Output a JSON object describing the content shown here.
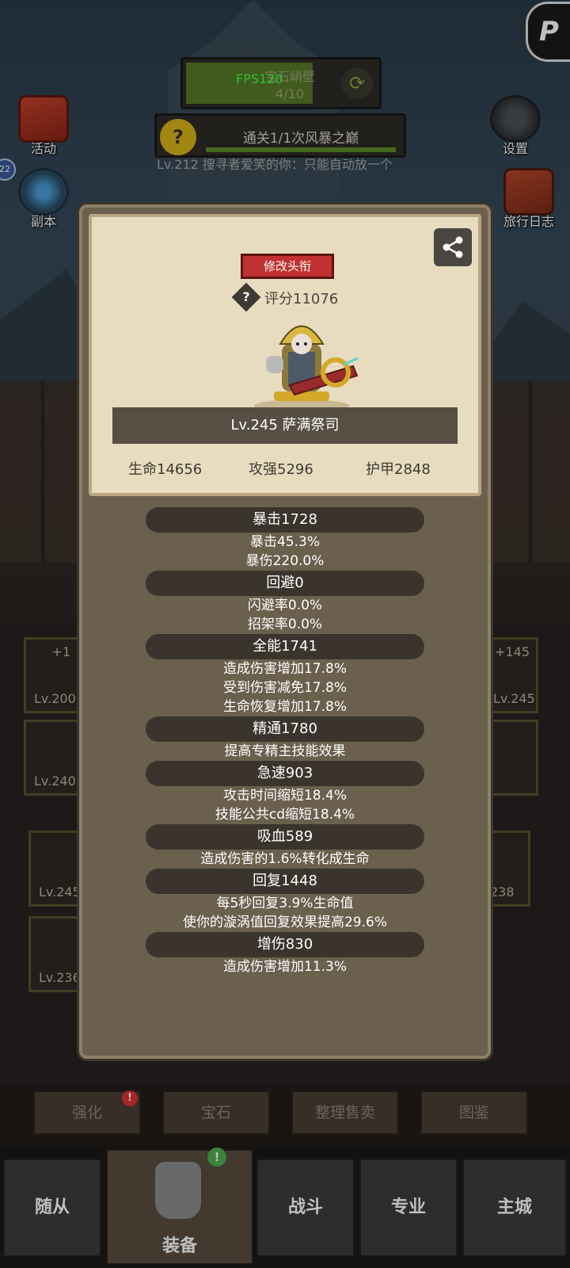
{
  "hud": {
    "mission_name": "宝石峭壁",
    "mission_progress": "4/10",
    "fps": "FPS120",
    "quest_text": "通关1/1次风暴之巅",
    "quest_icon": "?",
    "chat_text": "Lv.212 搜寻者爱笑的你：只能自动放一个",
    "badge_count": "22"
  },
  "side_buttons": {
    "activity": "活动",
    "dungeon": "副本",
    "settings": "设置",
    "journal": "旅行日志"
  },
  "background_slots": [
    {
      "lv": "Lv.200",
      "plus": "+1"
    },
    {
      "lv": "Lv.245",
      "plus": "+145"
    },
    {
      "lv": "Lv.240",
      "plus": ""
    },
    {
      "lv": "Lv.245",
      "plus": ""
    },
    {
      "lv": "Lv.236",
      "plus": ""
    },
    {
      "lv": "238",
      "plus": ""
    }
  ],
  "tools": {
    "enhance": "强化",
    "gem": "宝石",
    "sort_sell": "整理售卖",
    "codex": "图鉴",
    "enhance_alert": "!"
  },
  "nav": {
    "followers": "随从",
    "equipment": "装备",
    "battle": "战斗",
    "profession": "专业",
    "city": "主城",
    "equipment_alert": "!"
  },
  "popup": {
    "title_button": "修改头衔",
    "help_icon": "?",
    "score": "评分11076",
    "hero_name": "Lv.245 萨满祭司",
    "hp": "生命14656",
    "attack": "攻强5296",
    "armor": "护甲2848",
    "attributes": [
      {
        "head": "暴击1728",
        "lines": [
          "暴击45.3%",
          "暴伤220.0%"
        ]
      },
      {
        "head": "回避0",
        "lines": [
          "闪避率0.0%",
          "招架率0.0%"
        ]
      },
      {
        "head": "全能1741",
        "lines": [
          "造成伤害增加17.8%",
          "受到伤害减免17.8%",
          "生命恢复增加17.8%"
        ]
      },
      {
        "head": "精通1780",
        "lines": [
          "提高专精主技能效果"
        ]
      },
      {
        "head": "急速903",
        "lines": [
          "攻击时间缩短18.4%",
          "技能公共cd缩短18.4%"
        ]
      },
      {
        "head": "吸血589",
        "lines": [
          "造成伤害的1.6%转化成生命"
        ]
      },
      {
        "head": "回复1448",
        "lines": [
          "每5秒回复3.9%生命值",
          "使你的漩涡值回复效果提高29.6%"
        ]
      },
      {
        "head": "增伤830",
        "lines": [
          "造成伤害增加11.3%"
        ]
      }
    ]
  },
  "colors": {
    "title_button": "#c23131",
    "popup_bg": "#6b5f4e",
    "card_bg": "#e8dcc0",
    "fps_text": "#3fff3f"
  },
  "icons": {
    "share": "share-icon",
    "refresh": "refresh-icon",
    "corner_logo": "P"
  }
}
